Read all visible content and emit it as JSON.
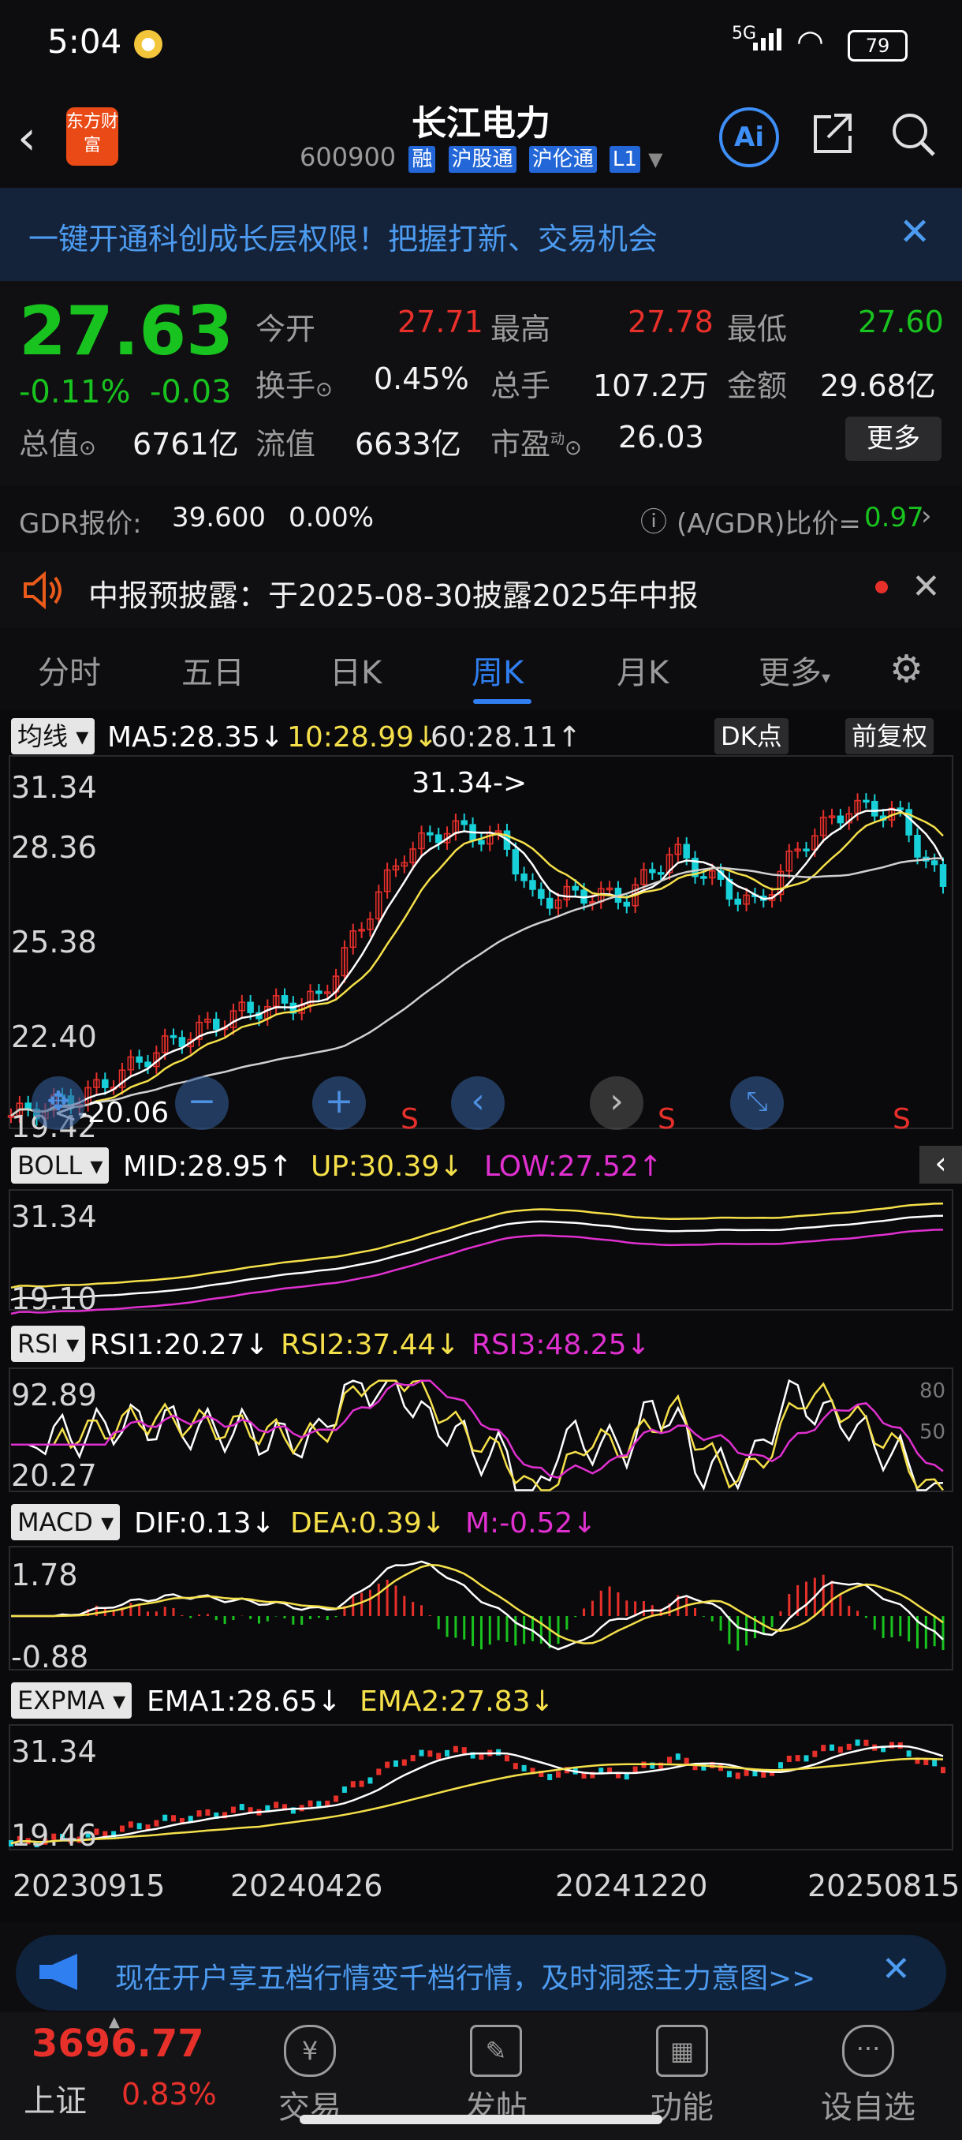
{
  "status_bar": {
    "time": "5:04",
    "network": "5G",
    "battery": "79"
  },
  "header": {
    "logo_text": "东方财富",
    "title": "长江电力",
    "code": "600900",
    "tags": [
      "融",
      "沪股通",
      "沪伦通",
      "L1"
    ],
    "ai_label": "Ai"
  },
  "banner": {
    "text": "一键开通科创成长层权限！把握打新、交易机会"
  },
  "quote": {
    "price": "27.63",
    "change_pct": "-0.11%",
    "change": "-0.03",
    "open_label": "今开",
    "open": "27.71",
    "high_label": "最高",
    "high": "27.78",
    "low_label": "最低",
    "low": "27.60",
    "turnover_label": "换手",
    "turnover": "0.45%",
    "volume_label": "总手",
    "volume": "107.2万",
    "amount_label": "金额",
    "amount": "29.68亿",
    "mktcap_label": "总值",
    "mktcap": "6761亿",
    "float_label": "流值",
    "float": "6633亿",
    "pe_label": "市盈",
    "pe_sup": "动",
    "pe": "26.03",
    "more_label": "更多"
  },
  "gdr": {
    "label": "GDR报价:",
    "price": "39.600",
    "pct": "0.00%",
    "ratio_label": "(A/GDR)比价=",
    "ratio": "0.97"
  },
  "disclosure": {
    "text": "中报预披露：于2025-08-30披露2025年中报"
  },
  "tabs": [
    {
      "label": "分时"
    },
    {
      "label": "五日"
    },
    {
      "label": "日K"
    },
    {
      "label": "周K"
    },
    {
      "label": "月K"
    },
    {
      "label": "更多"
    }
  ],
  "indicators": {
    "ma": {
      "btn": "均线",
      "ma5": "MA5:28.35",
      "ma10": "10:28.99",
      "ma60": "60:28.11",
      "dk": "DK点",
      "adj": "前复权"
    },
    "main_axis": [
      "31.34",
      "28.36",
      "25.38",
      "22.40",
      "19.42"
    ],
    "main_high_label": "31.34->",
    "main_low_label": "<-20.06",
    "boll": {
      "btn": "BOLL",
      "mid": "MID:28.95",
      "up": "UP:30.39",
      "low": "LOW:27.52",
      "axis_top": "31.34",
      "axis_bottom": "19.10"
    },
    "rsi": {
      "btn": "RSI",
      "rsi1": "RSI1:20.27",
      "rsi2": "RSI2:37.44",
      "rsi3": "RSI3:48.25",
      "axis_top": "92.89",
      "axis_bottom": "20.27",
      "lvl80": "80",
      "lvl50": "50"
    },
    "macd": {
      "btn": "MACD",
      "dif": "DIF:0.13",
      "dea": "DEA:0.39",
      "m": "M:-0.52",
      "axis_top": "1.78",
      "axis_bottom": "-0.88"
    },
    "expma": {
      "btn": "EXPMA",
      "ema1": "EMA1:28.65",
      "ema2": "EMA2:27.83",
      "axis_top": "31.34",
      "axis_bottom": "19.46"
    },
    "dates": [
      "20230915",
      "20240426",
      "20241220",
      "20250815"
    ],
    "s_marks": [
      "S",
      "S",
      "S"
    ]
  },
  "ad": {
    "text": "现在开户享五档行情变千档行情，及时洞悉主力意图>>"
  },
  "bottom_nav": {
    "index_value": "3696.77",
    "index_name": "上证",
    "index_pct": "0.83%",
    "items": [
      {
        "label": "交易"
      },
      {
        "label": "发帖"
      },
      {
        "label": "功能"
      },
      {
        "label": "设自选"
      }
    ]
  },
  "colors": {
    "up": "#e8302b",
    "down": "#19c31f",
    "accent": "#2f7ff0",
    "ma10": "#f5e04a",
    "ma60": "#e0e0e0",
    "magenta": "#e030d0"
  }
}
